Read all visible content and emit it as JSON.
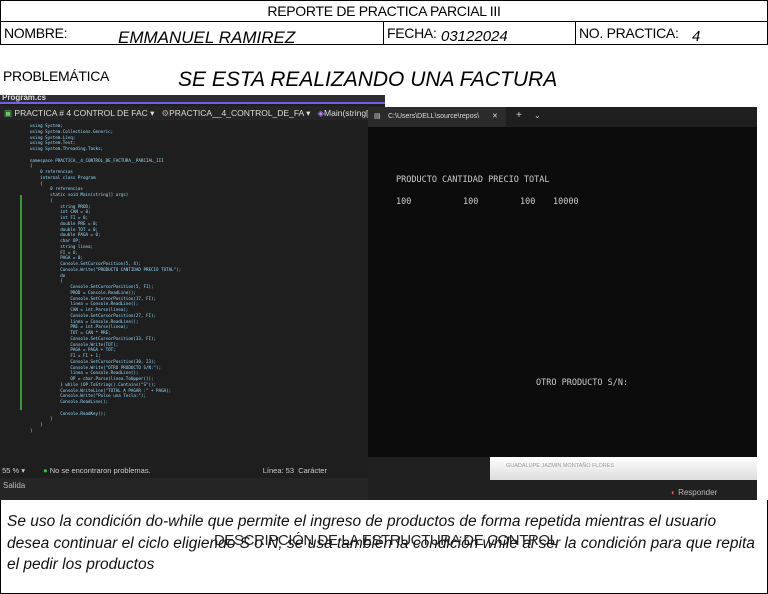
{
  "report": {
    "title": "REPORTE DE PRACTICA PARCIAL III",
    "nombre_label": "NOMBRE:",
    "nombre_value": "EMMANUEL RAMIREZ",
    "fecha_label": "FECHA:",
    "fecha_value": "03122024",
    "practica_label": "NO. PRACTICA:",
    "practica_value": "4",
    "problematica_label": "PROBLEMÁTICA",
    "problematica_value": "SE ESTA REALIZANDO UNA FACTURA",
    "description_label": "DESCRIPCIÓN DE LA ESTRUCTURA DE CONTROL",
    "description_text": "Se uso la condición do-while que permite el ingreso de productos de forma repetida mientras el usuario desea continuar el ciclo eligiendo S o N, se usa también la condición while al ser la condición para que repita el pedir los productos"
  },
  "ide": {
    "file_tab": "Program.cs",
    "nav_project": "PRACTICA # 4 CONTROL DE FAC",
    "nav_class": "PRACTICA__4_CONTROL_DE_FA",
    "nav_method": "Main(string[] args)",
    "code": "using System;\nusing System.Collections.Generic;\nusing System.Linq;\nusing System.Text;\nusing System.Threading.Tasks;\n\nnamespace PRACTICA__4_CONTROL_DE_FACTURA__PARCIAL_III\n{\n    0 referencias\n    internal class Program\n    {\n        0 referencias\n        static void Main(string[] args)\n        {\n            string PROD;\n            int CAN = 0;\n            int FI = 8;\n            double PRE = 0;\n            double TOT = 0;\n            double PAGA = 0;\n            char OP;\n            string linea;\n            FI = 6;\n            PAGA = 0;\n            Console.SetCursorPosition(5, 4);\n            Console.Write(\"PRODUCTO CANTIDAD PRECIO TOTAL\");\n            do\n            {\n                Console.SetCursorPosition(5, FI);\n                PROD = Console.ReadLine();\n                Console.SetCursorPosition(17, FI);\n                linea = Console.ReadLine();\n                CAN = int.Parse(linea);\n                Console.SetCursorPosition(27, FI);\n                linea = Console.ReadLine();\n                PRE = int.Parse(linea);\n                TOT = CAN * PRE;\n                Console.SetCursorPosition(33, FI);\n                Console.Write(TOT);\n                PAGA = PAGA + TOT;\n                FI = FI + 1;\n                Console.SetCursorPosition(30, 23);\n                Console.Write(\"OTRO PRODUCTO S/N:\");\n                linea = Console.ReadLine();\n                OP = char.Parse(linea.ToUpper());\n            } while (OP.ToString().Contains(\"S\"));\n            Console.WriteLine(\"TOTAL A PAGAR :\" + PAGA);\n            Console.Write(\"Pulse una Tecla:\");\n            Console.ReadLine();\n\n            Console.ReadKey();\n        }\n    }\n}",
    "zoom": "55 %",
    "problems": "No se encontraron problemas.",
    "line": "Línea: 53",
    "char_label": "Carácter",
    "output_label": "Salida"
  },
  "terminal": {
    "tab_title": "C:\\Users\\DELL\\source\\repos\\",
    "header": "PRODUCTO CANTIDAD PRECIO TOTAL",
    "row": [
      "100",
      "100",
      "100",
      "10000"
    ],
    "prompt": "OTRO PRODUCTO S/N:"
  },
  "background": {
    "name": "GUADALUPE JAZMIN MONTAÑO FLORES",
    "reply": "Responder"
  }
}
